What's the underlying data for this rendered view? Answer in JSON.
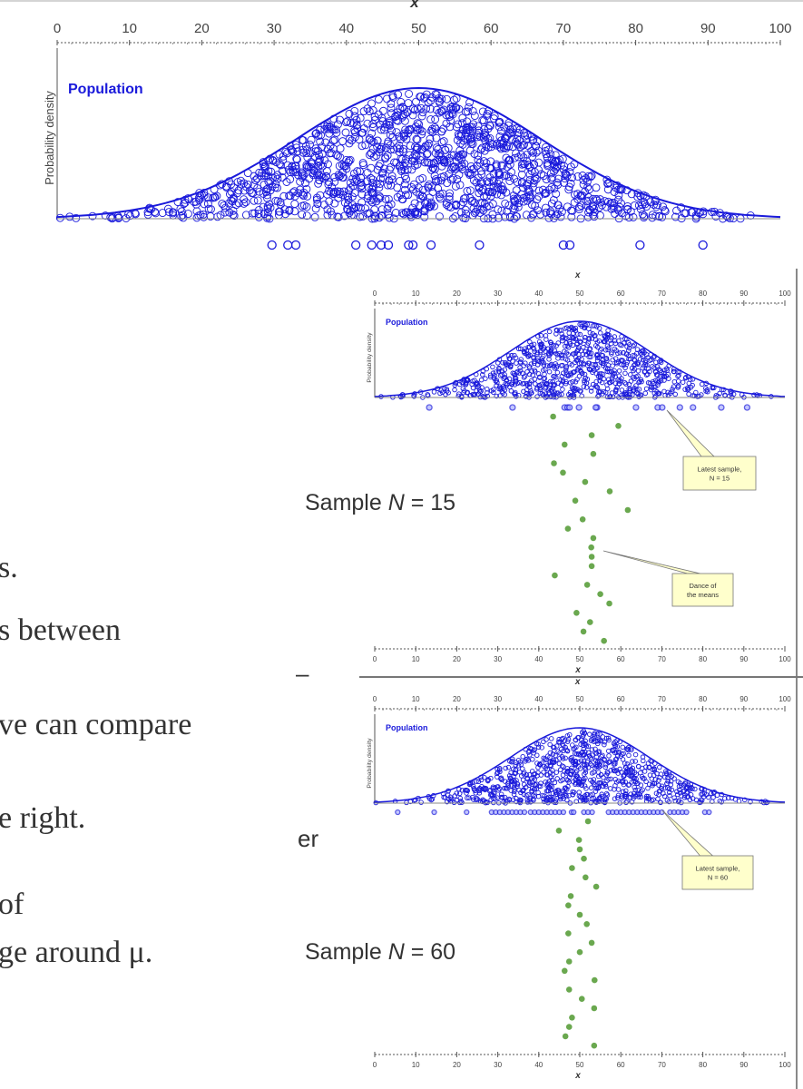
{
  "slide_text": {
    "line1": "s.",
    "line2": "s between",
    "line3": "–",
    "line4": "ve can compare",
    "line5": "e right.",
    "line6": "er",
    "line7": "of",
    "line8": "ge around μ."
  },
  "sample_labels": [
    {
      "prefix": "Sample ",
      "var": "N",
      "suffix": " = 15"
    },
    {
      "prefix": "Sample ",
      "var": "N",
      "suffix": " = 60"
    }
  ],
  "colors": {
    "population": "#1a1adb",
    "means": "#6aa84f",
    "callout_fill": "#ffffcc",
    "axis": "#555555"
  },
  "chart_data": [
    {
      "type": "scatter",
      "xlabel": "x",
      "ylabel": "Probability density",
      "series_label": "Population",
      "xlim": [
        0,
        100
      ],
      "xticks": [
        0,
        10,
        20,
        30,
        40,
        50,
        60,
        70,
        80,
        90,
        100
      ],
      "population_curve": {
        "shape": "normal",
        "mean": 50,
        "sd": 17
      },
      "sample_points": [
        29.7,
        31.9,
        33,
        41.3,
        43.5,
        44.8,
        45.8,
        48.6,
        49.2,
        51.7,
        58.4,
        70,
        70.9,
        80.6,
        89.3
      ]
    },
    {
      "type": "scatter",
      "xlabel": "x",
      "ylabel": "Probability density",
      "series_label": "Population",
      "xlim": [
        0,
        100
      ],
      "xticks": [
        0,
        10,
        20,
        30,
        40,
        50,
        60,
        70,
        80,
        90,
        100
      ],
      "population_curve": {
        "shape": "normal",
        "mean": 50,
        "sd": 17
      },
      "sample_size": 15,
      "latest_sample": [
        13.3,
        33.6,
        46.3,
        47,
        49.8,
        54.2,
        63.7,
        69,
        70.1,
        74.4,
        77.6,
        84.5,
        90.8,
        47.5,
        53.9
      ],
      "sample_means": [
        43.5,
        59.4,
        52.9,
        46.3,
        53.3,
        43.7,
        45.9,
        51.3,
        57.3,
        48.9,
        61.7,
        50.7,
        47.1,
        53.3,
        52.8,
        52.9,
        52.9,
        43.9,
        51.8,
        55,
        57.2,
        49.2,
        52.5,
        50.9,
        55.9
      ],
      "annotations": [
        "Latest sample, N = 15",
        "Dance of the means"
      ]
    },
    {
      "type": "scatter",
      "xlabel": "x",
      "ylabel": "Probability density",
      "series_label": "Population",
      "xlim": [
        0,
        100
      ],
      "xticks": [
        0,
        10,
        20,
        30,
        40,
        50,
        60,
        70,
        80,
        90,
        100
      ],
      "population_curve": {
        "shape": "normal",
        "mean": 50,
        "sd": 17
      },
      "sample_size": 60,
      "latest_sample": [
        5.6,
        14.5,
        22.4,
        28.5,
        29.5,
        30.5,
        31.5,
        32.5,
        33.5,
        34.5,
        35.5,
        36.5,
        38,
        39,
        40,
        41,
        42,
        43,
        44,
        45,
        46,
        48,
        48.5,
        51,
        52,
        53,
        57,
        58,
        59,
        60,
        61,
        62,
        63,
        64,
        65,
        66,
        67,
        68,
        69,
        70,
        72,
        73,
        74,
        75,
        76,
        80.5,
        81.5
      ],
      "sample_means": [
        52,
        44.9,
        49.8,
        50,
        51,
        48.1,
        51.4,
        54,
        47.8,
        47.2,
        50,
        51.7,
        47.2,
        52.9,
        50,
        47.4,
        46.3,
        53.6,
        47.4,
        50.5,
        53.5,
        48.1,
        47.4,
        46.5,
        53.5
      ],
      "annotations": [
        "Latest sample, N = 60"
      ]
    }
  ]
}
